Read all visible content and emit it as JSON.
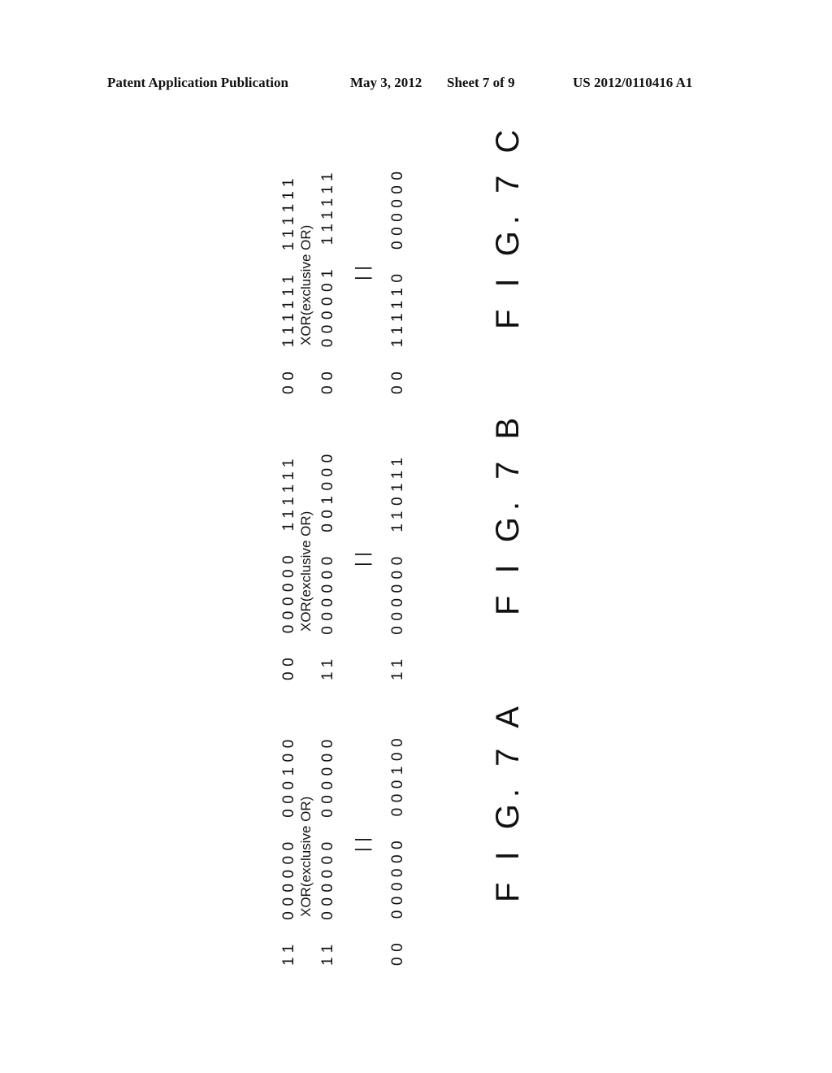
{
  "header": {
    "left": "Patent Application Publication",
    "date": "May 3, 2012",
    "sheet": "Sheet 7 of 9",
    "number": "US 2012/0110416 A1"
  },
  "figures": [
    {
      "id": "7C",
      "label": "F I G. 7 C",
      "operand_a": "00  111111  111111",
      "operator": "XOR(exclusive OR)",
      "operand_b": "00  000001  111111",
      "equals": "||",
      "result": "00  111110  000000"
    },
    {
      "id": "7B",
      "label": "F I G. 7 B",
      "operand_a": "00  000000  111111",
      "operator": "XOR(exclusive OR)",
      "operand_b": "11  000000  001000",
      "equals": "||",
      "result": "11  000000  110111"
    },
    {
      "id": "7A",
      "label": "F I G. 7 A",
      "operand_a": "11  000000  000100",
      "operator": "XOR(exclusive OR)",
      "operand_b": "11  000000  000000",
      "equals": "||",
      "result": "00  000000  000100"
    }
  ]
}
